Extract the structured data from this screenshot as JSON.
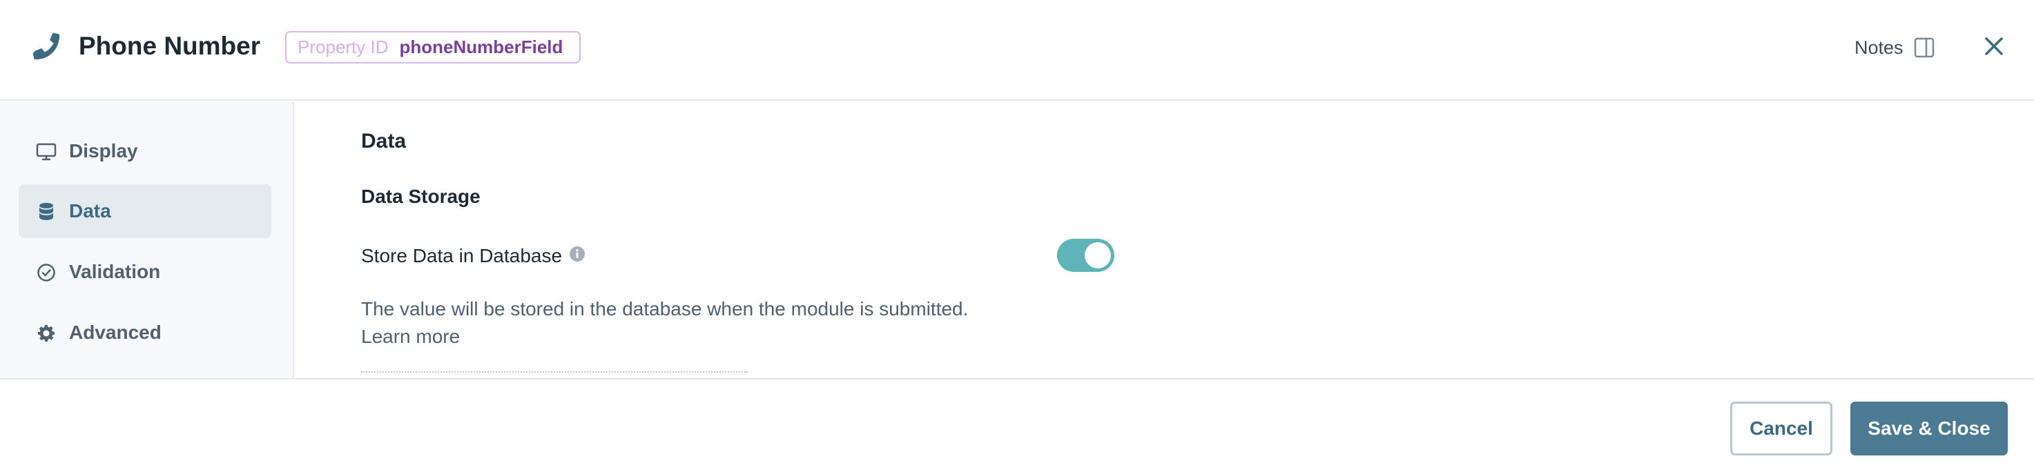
{
  "header": {
    "title": "Phone Number",
    "title_icon": "phone-icon",
    "property_id_label": "Property ID",
    "property_id_value": "phoneNumberField",
    "notes_label": "Notes",
    "notes_icon": "panel-toggle-icon",
    "close_icon": "close-icon"
  },
  "sidebar": {
    "items": [
      {
        "label": "Display",
        "icon": "monitor-icon",
        "active": false
      },
      {
        "label": "Data",
        "icon": "database-icon",
        "active": true
      },
      {
        "label": "Validation",
        "icon": "check-circle-icon",
        "active": false
      },
      {
        "label": "Advanced",
        "icon": "gear-icon",
        "active": false
      }
    ]
  },
  "main": {
    "section_title": "Data",
    "subsection_title": "Data Storage",
    "store_data_label": "Store Data in Database",
    "store_data_enabled": true,
    "help_text": "The value will be stored in the database when the module is submitted.",
    "learn_more": "Learn more"
  },
  "footer": {
    "cancel_label": "Cancel",
    "save_label": "Save & Close"
  },
  "colors": {
    "accent": "#4b7a92",
    "toggle_on": "#5fb4ba",
    "property_id_value": "#7b3fa0",
    "active_nav_bg": "#e5eaef"
  }
}
